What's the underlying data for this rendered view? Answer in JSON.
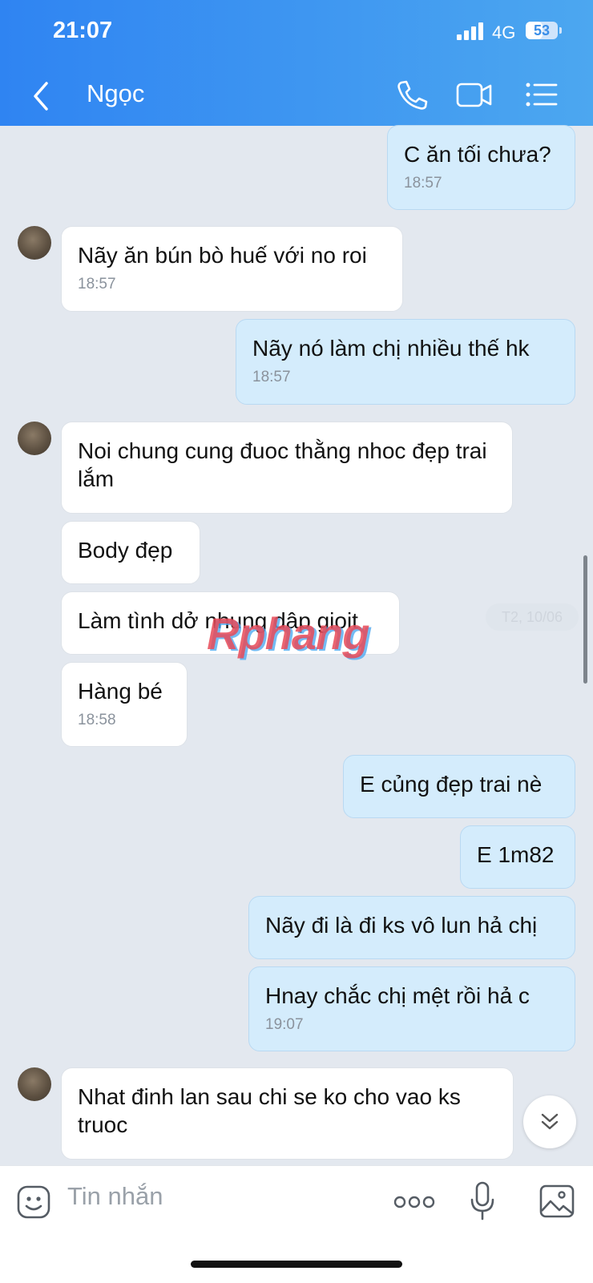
{
  "status": {
    "time": "21:07",
    "network": "4G",
    "battery": "53",
    "battery_level": 0.53
  },
  "header": {
    "contact_name": "Ngọc"
  },
  "messages": [
    {
      "text": "C ăn tối chưa?",
      "time": "18:57"
    },
    {
      "text": "Nãy ăn bún bò huế với no roi",
      "time": "18:57"
    },
    {
      "text": "Nãy nó làm chị nhiều thế hk",
      "time": "18:57"
    },
    {
      "text": "Noi chung cung đuoc thằng nhoc đẹp trai lắm"
    },
    {
      "text": "Body đẹp"
    },
    {
      "text": "Làm tình dở nhung dâp gioit"
    },
    {
      "text": "Hàng bé",
      "time": "18:58"
    },
    {
      "text": "E củng đẹp trai nè"
    },
    {
      "text": "E 1m82"
    },
    {
      "text": "Nãy đi là đi ks vô lun hả chị"
    },
    {
      "text": "Hnay chắc chị mệt rồi hả c",
      "time": "19:07"
    },
    {
      "text": "Nhat đinh lan sau chi se ko cho vao ks truoc"
    }
  ],
  "date_chip": "T2, 10/06",
  "watermark": "Rphang",
  "input": {
    "placeholder": "Tin nhắn"
  }
}
